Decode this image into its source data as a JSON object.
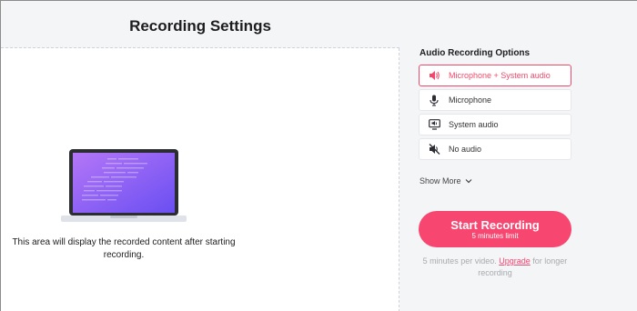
{
  "header": {
    "title": "Recording Settings"
  },
  "preview": {
    "message": "This area will display the recorded content after starting recording."
  },
  "audio": {
    "title": "Audio Recording Options",
    "options": [
      {
        "label": "Microphone + System audio",
        "icon": "speaker-icon",
        "selected": true
      },
      {
        "label": "Microphone",
        "icon": "microphone-icon",
        "selected": false
      },
      {
        "label": "System audio",
        "icon": "monitor-audio-icon",
        "selected": false
      },
      {
        "label": "No audio",
        "icon": "mute-icon",
        "selected": false
      }
    ],
    "show_more": "Show More"
  },
  "start": {
    "label": "Start Recording",
    "sub": "5 minutes limit"
  },
  "note": {
    "prefix": "5 minutes per video.",
    "link": "Upgrade",
    "suffix": "for longer recording"
  },
  "colors": {
    "accent": "#f74670",
    "panel": "#f4f5f7",
    "laptop_screen": "#8a5cf6"
  }
}
